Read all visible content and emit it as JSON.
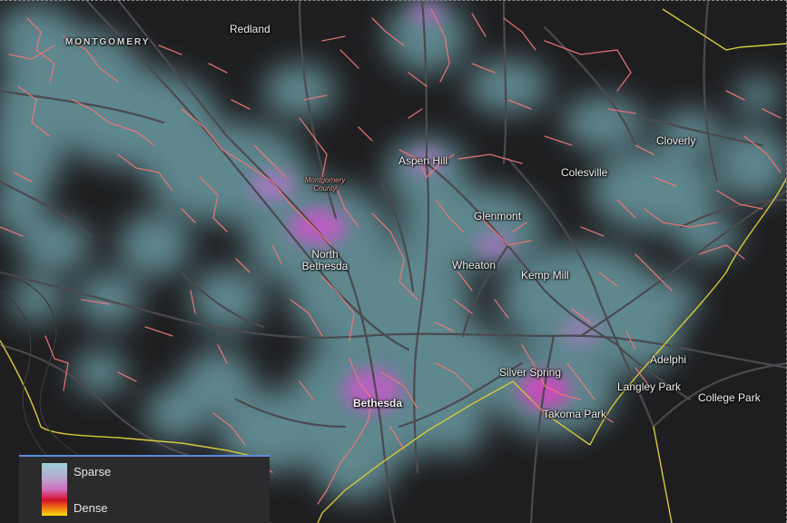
{
  "map": {
    "county_label": "MONTGOMERY",
    "places": [
      {
        "key": "redland",
        "text": "Redland"
      },
      {
        "key": "aspen_hill",
        "text": "Aspen Hill"
      },
      {
        "key": "montgomery_county",
        "text": "Montgomery County"
      },
      {
        "key": "glenmont",
        "text": "Glenmont"
      },
      {
        "key": "colesville",
        "text": "Colesville"
      },
      {
        "key": "cloverly",
        "text": "Cloverly"
      },
      {
        "key": "north_bethesda",
        "text": "North Bethesda"
      },
      {
        "key": "wheaton",
        "text": "Wheaton"
      },
      {
        "key": "kemp_mill",
        "text": "Kemp Mill"
      },
      {
        "key": "adelphi",
        "text": "Adelphi"
      },
      {
        "key": "silver_spring",
        "text": "Silver Spring"
      },
      {
        "key": "langley_park",
        "text": "Langley Park"
      },
      {
        "key": "college_park",
        "text": "College Park"
      },
      {
        "key": "bethesda",
        "text": "Bethesda"
      },
      {
        "key": "takoma_park",
        "text": "Takoma Park"
      }
    ]
  },
  "legend": {
    "sparse_label": "Sparse",
    "dense_label": "Dense"
  },
  "colors": {
    "background": "#1e1e20",
    "heat_sparse": "#8fd3dc",
    "heat_mid": "#c06cc8",
    "heat_dense": "#d0102a",
    "roads": "#f07878",
    "boundary": "#d6c83a",
    "highways": "#4a4a4e"
  }
}
